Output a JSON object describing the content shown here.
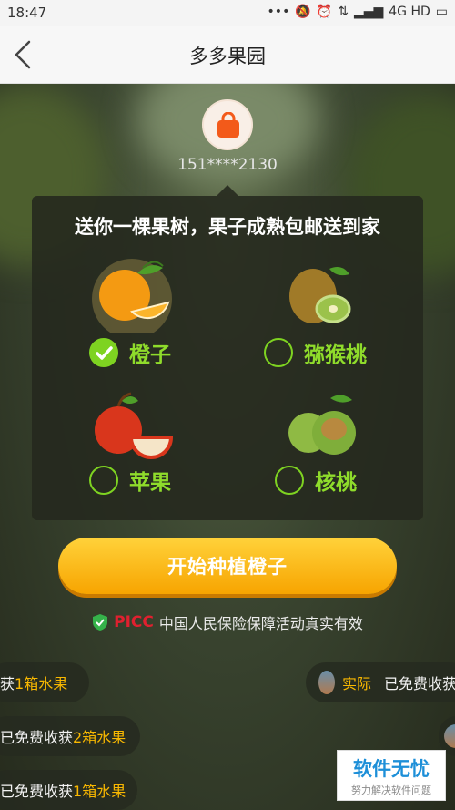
{
  "status_bar": {
    "time": "18:47",
    "network": "4G HD",
    "icons": [
      "more-dots-icon",
      "mute-icon",
      "alarm-icon",
      "data-icon",
      "signal-icon",
      "battery-icon"
    ]
  },
  "nav": {
    "title": "多多果园",
    "back_icon": "chevron-left-icon"
  },
  "user": {
    "avatar_icon": "shopping-bag-icon",
    "phone": "151****2130"
  },
  "card": {
    "title": "送你一棵果树，果子成熟包邮送到家",
    "fruits": [
      {
        "label": "橙子",
        "selected": true,
        "icon": "orange-icon"
      },
      {
        "label": "猕猴桃",
        "selected": false,
        "icon": "kiwi-icon"
      },
      {
        "label": "苹果",
        "selected": false,
        "icon": "apple-icon"
      },
      {
        "label": "核桃",
        "selected": false,
        "icon": "walnut-icon"
      }
    ]
  },
  "cta": {
    "label": "开始种植橙子"
  },
  "insurance": {
    "logo": "PICC",
    "text": "中国人民保险保障活动真实有效"
  },
  "ticker": {
    "row1_left_a": "获",
    "row1_left_b": "1箱水果",
    "row1_right_name": "实际",
    "row1_right_text": "已免费收获",
    "row2_a": "已免费收获",
    "row2_b": "2箱水果",
    "row3_a": "已免费收获",
    "row3_b": "1箱水果"
  },
  "watermark": {
    "main": "软件无忧",
    "sub": "努力解决软件问题"
  },
  "colors": {
    "accent_green": "#7ed321",
    "cta_orange": "#f7a400",
    "highlight_yellow": "#f9b800",
    "picc_red": "#e0202f"
  }
}
